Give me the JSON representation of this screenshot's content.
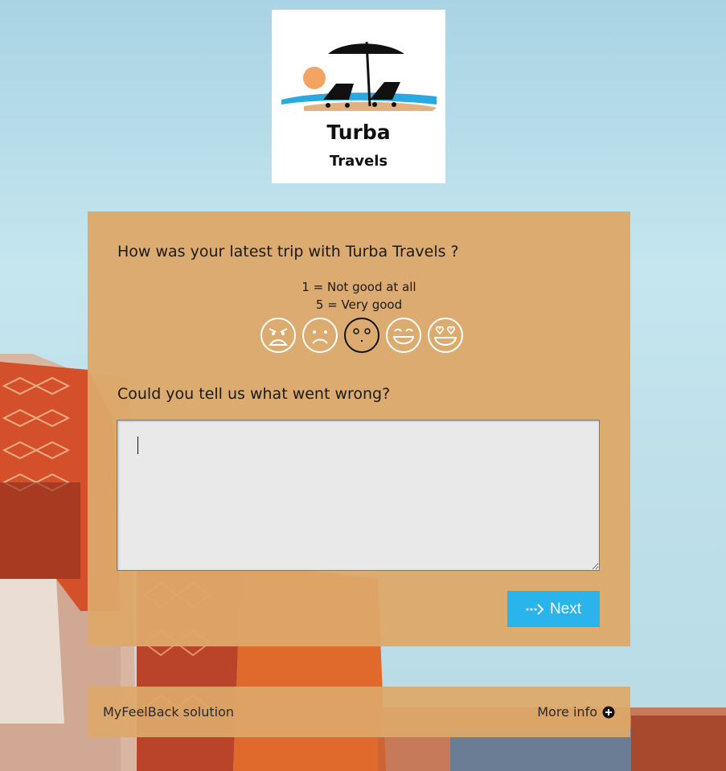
{
  "logo": {
    "title": "Turba",
    "subtitle": "Travels"
  },
  "survey": {
    "question1": "How was your latest trip with Turba Travels ?",
    "scale_low": "1 = Not good at all",
    "scale_high": "5 = Very good",
    "faces": [
      "angry-face-icon",
      "sad-face-icon",
      "neutral-face-icon",
      "happy-face-icon",
      "love-face-icon"
    ],
    "selected_rating": 3,
    "question2": "Could you tell us what went wrong?",
    "answer_value": "",
    "next_label": "Next"
  },
  "footer": {
    "brand": "MyFeelBack solution",
    "more_info": "More info"
  },
  "colors": {
    "card": "#dda869",
    "button": "#29b4ec",
    "textarea": "#e9e9e9"
  }
}
